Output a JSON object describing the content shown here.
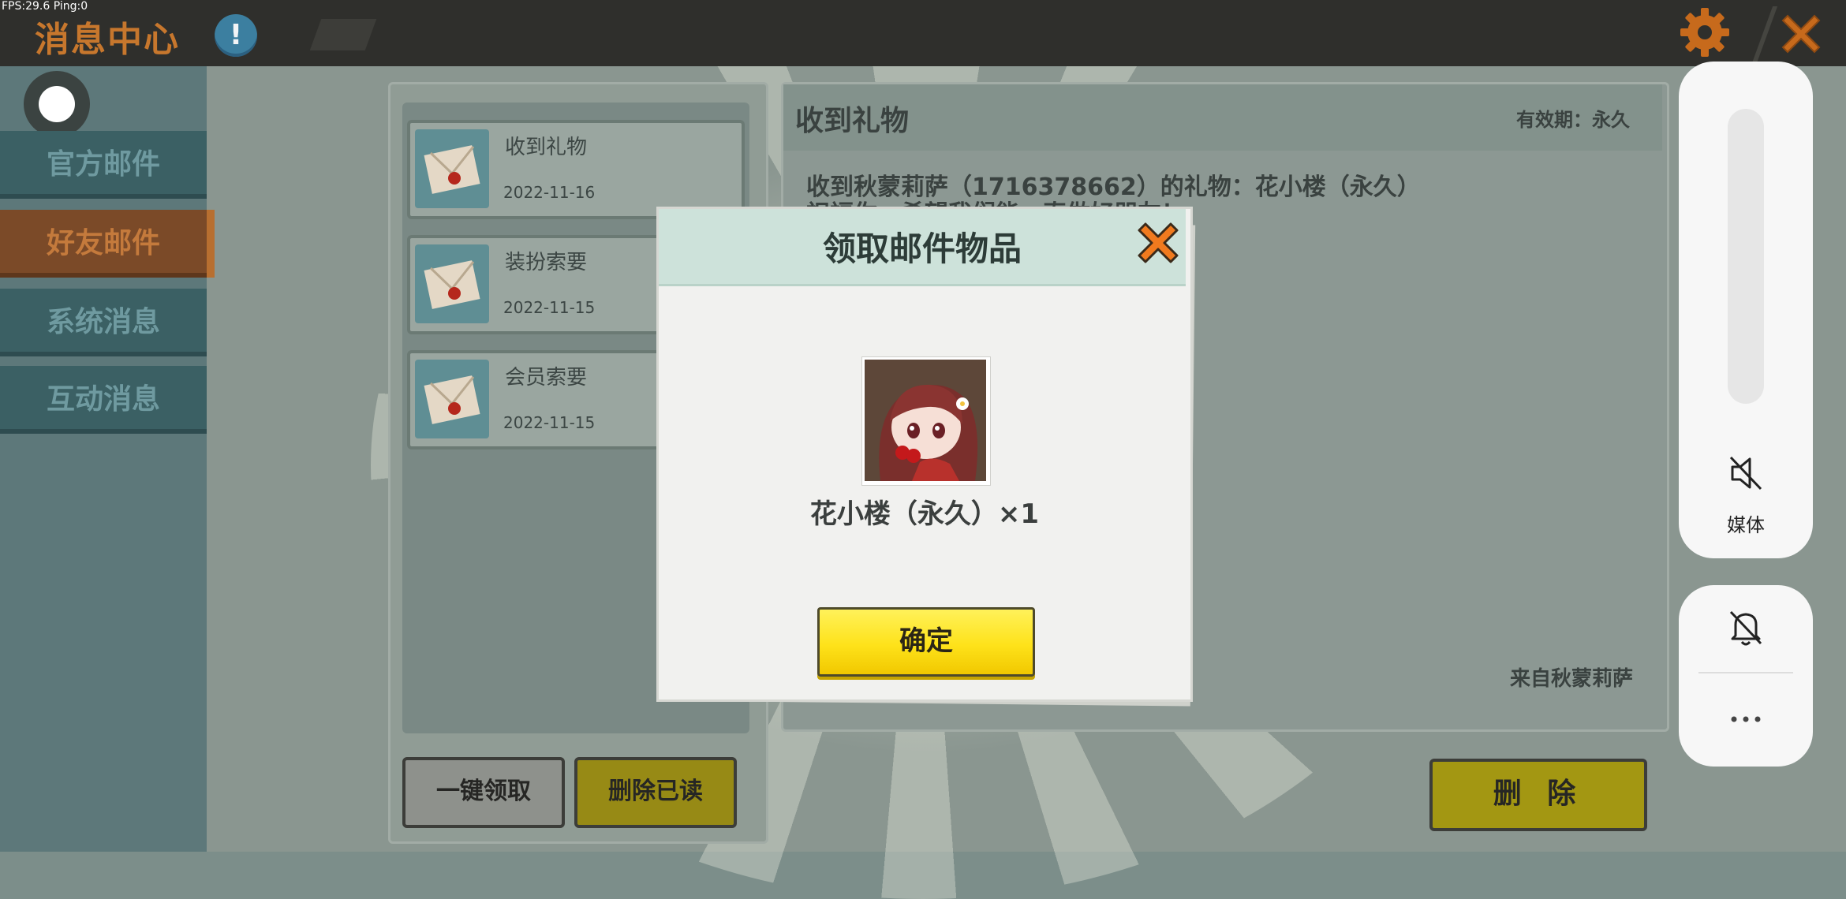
{
  "status": {
    "fps_text": "FPS:29.6  Ping:0"
  },
  "header": {
    "title": "消息中心",
    "alert_glyph": "!",
    "icons": [
      "alert-icon",
      "gear-icon",
      "close-icon"
    ]
  },
  "sidebar": {
    "tabs": [
      {
        "label": "官方邮件",
        "active": false
      },
      {
        "label": "好友邮件",
        "active": true
      },
      {
        "label": "系统消息",
        "active": false
      },
      {
        "label": "互动消息",
        "active": false
      }
    ]
  },
  "mail_list": {
    "items": [
      {
        "title": "收到礼物",
        "date": "2022-11-16",
        "icon": "envelope-icon"
      },
      {
        "title": "装扮索要",
        "date": "2022-11-15",
        "icon": "envelope-icon"
      },
      {
        "title": "会员索要",
        "date": "2022-11-15",
        "icon": "envelope-icon"
      }
    ],
    "claim_all_label": "一键领取",
    "delete_read_label": "删除已读"
  },
  "detail": {
    "title": "收到礼物",
    "validity": "有效期：永久",
    "body_line1": "收到秋蒙莉萨（1716378662）的礼物：花小楼（永久）",
    "body_line2": "祝福你，希望我们能一直做好朋友！",
    "from": "来自秋蒙莉萨",
    "delete_label": "删 除"
  },
  "modal": {
    "title": "领取邮件物品",
    "item_name": "花小楼（永久）×1",
    "confirm_label": "确定",
    "colors": {
      "header": "#cde2da",
      "confirm": "#fee21a",
      "close": "#f07a1e"
    }
  },
  "volume_overlay": {
    "media_label": "媒体",
    "icons": [
      "speaker-muted-icon",
      "bell-off-icon",
      "more-icon"
    ]
  }
}
